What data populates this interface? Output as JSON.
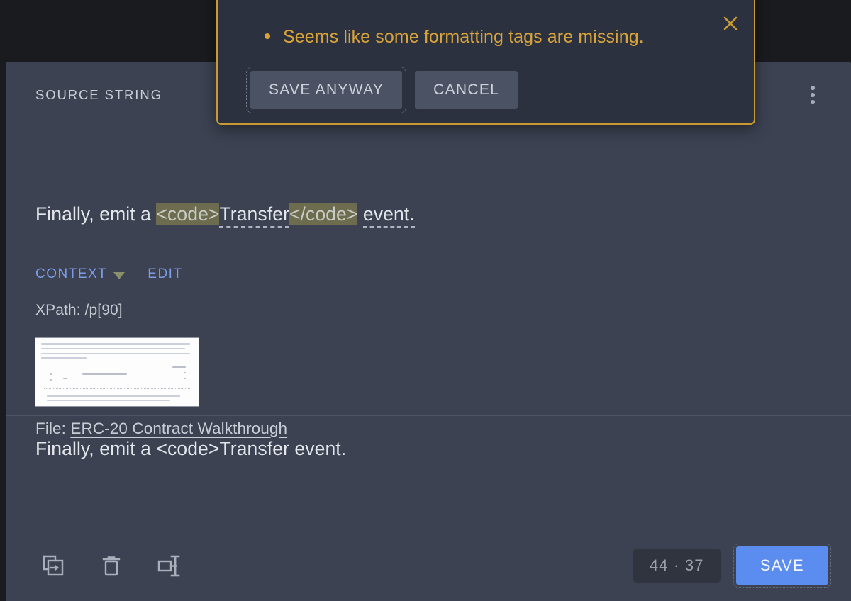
{
  "colors": {
    "page_background": "#1a1b1f",
    "card_background": "#3c4252",
    "dialog_background": "#2b313f",
    "dialog_border": "#c99a32",
    "warning_text": "#d9a33a",
    "link_blue": "#7b9ce8",
    "save_button": "#5b8cf0",
    "tag_highlight": "#6d6c4f"
  },
  "header": {
    "source_label": "SOURCE STRING",
    "menu_icon": "kebab-menu-icon"
  },
  "source_string": {
    "segments": [
      {
        "text": "Finally, emit a ",
        "style": "plain"
      },
      {
        "text": "<code>",
        "style": "tag-highlight"
      },
      {
        "text": "Transfer",
        "style": "term-underline"
      },
      {
        "text": "</code>",
        "style": "tag-highlight"
      },
      {
        "text": " ",
        "style": "plain"
      },
      {
        "text": "event.",
        "style": "term-underline"
      }
    ],
    "plain_text": "Finally, emit a <code>Transfer</code> event."
  },
  "context": {
    "toggle_label": "CONTEXT",
    "caret_icon": "chevron-down-icon",
    "edit_label": "EDIT",
    "xpath_label": "XPath:",
    "xpath_value": "/p[90]",
    "xpath_line": "XPath: /p[90]",
    "thumbnail_icon": "context-screenshot-thumbnail",
    "file_label": "File:",
    "file_name": "ERC-20 Contract Walkthrough"
  },
  "translation": {
    "value": "Finally, emit a <code>Transfer event.",
    "placeholder": ""
  },
  "toolbar": {
    "icons": [
      {
        "name": "copy-source-to-target-icon",
        "label": "Copy source to target"
      },
      {
        "name": "trash-icon",
        "label": "Delete"
      },
      {
        "name": "split-segment-icon",
        "label": "Split segment"
      }
    ],
    "counter": "44 · 37",
    "counter_source": "44",
    "counter_target": "37",
    "save_label": "SAVE"
  },
  "dialog": {
    "close_icon": "close-x-icon",
    "messages": [
      "Seems like some formatting tags are missing."
    ],
    "message": "Seems like some formatting tags are missing.",
    "save_anyway_label": "SAVE ANYWAY",
    "cancel_label": "CANCEL"
  }
}
